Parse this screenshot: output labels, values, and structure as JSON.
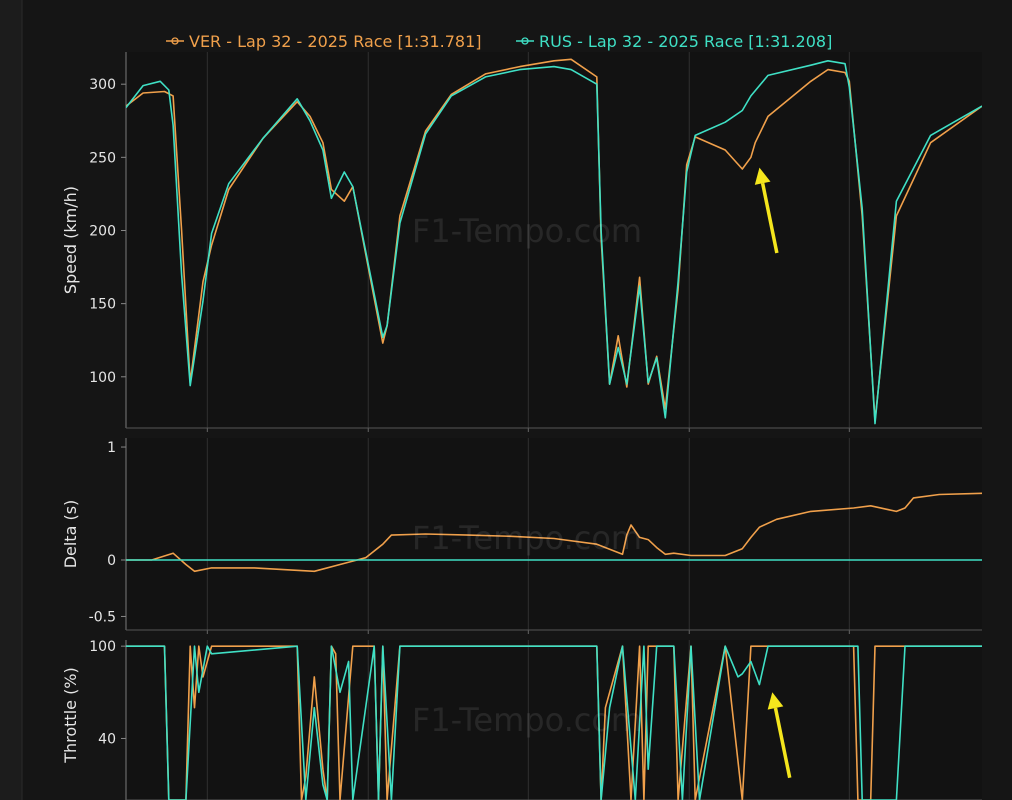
{
  "legend": {
    "ver_label": "VER - Lap 32 - 2025 Race [1:31.781]",
    "rus_label": "RUS - Lap 32 - 2025 Race [1:31.208]"
  },
  "watermark": "F1-Tempo.com",
  "colors": {
    "ver": "#f0a04b",
    "rus": "#3fe0c5",
    "arrow": "#f5e61d",
    "background": "#151515",
    "panel": "#121212",
    "grid": "#303030",
    "text": "#e6e6e6"
  },
  "chart_data": [
    {
      "type": "line",
      "ylabel": "Speed (km/h)",
      "ylim": [
        65,
        322
      ],
      "yticks": [
        100,
        150,
        200,
        250,
        300
      ],
      "xlim": [
        0,
        1
      ],
      "grid": true,
      "legend_position": "top-center",
      "series": [
        {
          "name": "VER - Lap 32 - 2025 Race [1:31.781]",
          "x": [
            0,
            0.02,
            0.045,
            0.055,
            0.065,
            0.075,
            0.09,
            0.1,
            0.12,
            0.16,
            0.2,
            0.215,
            0.23,
            0.24,
            0.255,
            0.265,
            0.3,
            0.305,
            0.32,
            0.35,
            0.38,
            0.42,
            0.46,
            0.5,
            0.52,
            0.55,
            0.555,
            0.565,
            0.575,
            0.585,
            0.6,
            0.61,
            0.62,
            0.63,
            0.645,
            0.655,
            0.665,
            0.7,
            0.72,
            0.73,
            0.735,
            0.75,
            0.8,
            0.82,
            0.84,
            0.845,
            0.86,
            0.875,
            0.9,
            0.94,
            1.0
          ],
          "y": [
            285,
            294,
            295,
            292,
            200,
            96,
            165,
            190,
            228,
            263,
            288,
            278,
            260,
            228,
            220,
            230,
            123,
            135,
            210,
            268,
            293,
            307,
            312,
            316,
            317,
            305,
            195,
            95,
            128,
            93,
            168,
            95,
            114,
            78,
            160,
            245,
            264,
            255,
            242,
            250,
            260,
            278,
            302,
            310,
            308,
            302,
            210,
            70,
            210,
            260,
            285
          ]
        },
        {
          "name": "RUS - Lap 32 - 2025 Race [1:31.208]",
          "x": [
            0,
            0.02,
            0.04,
            0.05,
            0.055,
            0.065,
            0.075,
            0.09,
            0.1,
            0.12,
            0.16,
            0.2,
            0.215,
            0.23,
            0.24,
            0.255,
            0.265,
            0.3,
            0.305,
            0.32,
            0.35,
            0.38,
            0.42,
            0.46,
            0.5,
            0.52,
            0.55,
            0.555,
            0.565,
            0.575,
            0.585,
            0.6,
            0.61,
            0.62,
            0.63,
            0.645,
            0.655,
            0.665,
            0.7,
            0.72,
            0.73,
            0.75,
            0.8,
            0.82,
            0.84,
            0.845,
            0.86,
            0.875,
            0.9,
            0.94,
            1.0
          ],
          "y": [
            284,
            299,
            302,
            296,
            272,
            170,
            94,
            152,
            198,
            232,
            263,
            290,
            275,
            255,
            222,
            240,
            230,
            127,
            135,
            205,
            266,
            292,
            305,
            310,
            312,
            310,
            300,
            200,
            95,
            120,
            95,
            162,
            96,
            113,
            72,
            165,
            240,
            265,
            274,
            282,
            292,
            306,
            313,
            316,
            314,
            298,
            215,
            68,
            220,
            265,
            285
          ]
        }
      ],
      "annotations": [
        {
          "type": "arrow",
          "target_x": 0.74,
          "target_y": 243
        }
      ]
    },
    {
      "type": "line",
      "ylabel": "Delta (s)",
      "ylim": [
        -0.62,
        1.08
      ],
      "yticks": [
        -0.5,
        0,
        1
      ],
      "xlim": [
        0,
        1
      ],
      "grid": true,
      "series": [
        {
          "name": "VER - Lap 32 - 2025 Race [1:31.781]",
          "x": [
            0,
            0.03,
            0.055,
            0.07,
            0.08,
            0.1,
            0.15,
            0.22,
            0.25,
            0.27,
            0.28,
            0.3,
            0.31,
            0.35,
            0.4,
            0.45,
            0.5,
            0.55,
            0.58,
            0.585,
            0.59,
            0.6,
            0.61,
            0.62,
            0.63,
            0.64,
            0.66,
            0.7,
            0.72,
            0.73,
            0.74,
            0.76,
            0.8,
            0.85,
            0.87,
            0.9,
            0.91,
            0.92,
            0.95,
            1.0
          ],
          "y": [
            0.0,
            0.0,
            0.06,
            -0.04,
            -0.1,
            -0.07,
            -0.07,
            -0.1,
            -0.04,
            0.0,
            0.02,
            0.14,
            0.22,
            0.23,
            0.22,
            0.21,
            0.19,
            0.14,
            0.05,
            0.22,
            0.31,
            0.2,
            0.18,
            0.11,
            0.05,
            0.06,
            0.04,
            0.04,
            0.1,
            0.2,
            0.29,
            0.36,
            0.43,
            0.46,
            0.48,
            0.43,
            0.46,
            0.55,
            0.58,
            0.59
          ]
        },
        {
          "name": "RUS - Lap 32 - 2025 Race [1:31.208]",
          "x": [
            0,
            1
          ],
          "y": [
            0,
            0
          ]
        }
      ]
    },
    {
      "type": "line",
      "ylabel": "Throttle (%)",
      "ylim": [
        0,
        104
      ],
      "yticks": [
        40,
        100
      ],
      "xlim": [
        0,
        1
      ],
      "grid": true,
      "series": [
        {
          "name": "VER - Lap 32 - 2025 Race [1:31.781]",
          "x": [
            0,
            0.045,
            0.05,
            0.07,
            0.075,
            0.08,
            0.085,
            0.09,
            0.1,
            0.2,
            0.205,
            0.21,
            0.22,
            0.23,
            0.235,
            0.24,
            0.245,
            0.25,
            0.265,
            0.29,
            0.295,
            0.3,
            0.305,
            0.32,
            0.55,
            0.555,
            0.56,
            0.58,
            0.59,
            0.6,
            0.605,
            0.61,
            0.64,
            0.645,
            0.66,
            0.665,
            0.7,
            0.72,
            0.73,
            0.75,
            0.8,
            0.85,
            0.855,
            0.87,
            0.875,
            0.9,
            0.91,
            1.0
          ],
          "y": [
            100,
            100,
            0,
            0,
            100,
            60,
            100,
            80,
            100,
            100,
            0,
            15,
            80,
            20,
            0,
            100,
            95,
            0,
            100,
            100,
            0,
            100,
            0,
            100,
            100,
            0,
            60,
            100,
            0,
            100,
            0,
            100,
            100,
            0,
            100,
            0,
            100,
            0,
            100,
            100,
            100,
            100,
            0,
            0,
            100,
            100,
            100,
            100
          ]
        },
        {
          "name": "RUS - Lap 32 - 2025 Race [1:31.208]",
          "x": [
            0,
            0.045,
            0.05,
            0.07,
            0.08,
            0.085,
            0.095,
            0.1,
            0.2,
            0.21,
            0.22,
            0.23,
            0.235,
            0.24,
            0.25,
            0.26,
            0.265,
            0.29,
            0.295,
            0.3,
            0.31,
            0.32,
            0.55,
            0.555,
            0.565,
            0.58,
            0.595,
            0.605,
            0.61,
            0.62,
            0.64,
            0.65,
            0.66,
            0.67,
            0.7,
            0.715,
            0.72,
            0.73,
            0.74,
            0.75,
            0.8,
            0.855,
            0.86,
            0.9,
            0.91,
            1.0
          ],
          "y": [
            100,
            100,
            0,
            0,
            100,
            70,
            100,
            95,
            100,
            0,
            60,
            10,
            0,
            100,
            70,
            90,
            0,
            100,
            0,
            100,
            0,
            100,
            100,
            0,
            60,
            100,
            0,
            100,
            20,
            100,
            100,
            0,
            100,
            0,
            100,
            80,
            82,
            90,
            75,
            100,
            100,
            100,
            0,
            0,
            100,
            100
          ]
        }
      ],
      "annotations": [
        {
          "type": "arrow",
          "target_x": 0.755,
          "target_y": 70
        }
      ]
    }
  ]
}
